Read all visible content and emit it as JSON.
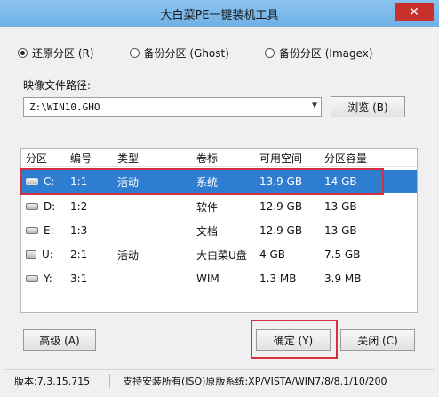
{
  "window": {
    "title": "大白菜PE一键装机工具",
    "close_glyph": "✕"
  },
  "modes": [
    {
      "label": "还原分区 (R)",
      "checked": true
    },
    {
      "label": "备份分区 (Ghost)",
      "checked": false
    },
    {
      "label": "备份分区 (Imagex)",
      "checked": false
    }
  ],
  "image_path": {
    "label": "映像文件路径:",
    "value": "Z:\\WIN10.GHO",
    "browse_label": "浏览 (B)"
  },
  "table": {
    "columns": [
      "分区",
      "编号",
      "类型",
      "卷标",
      "可用空间",
      "分区容量"
    ],
    "rows": [
      {
        "drive": "C:",
        "num": "1:1",
        "type": "活动",
        "label": "系统",
        "free": "13.9 GB",
        "size": "14 GB",
        "selected": true,
        "icon": "hdd-icon"
      },
      {
        "drive": "D:",
        "num": "1:2",
        "type": "",
        "label": "软件",
        "free": "12.9 GB",
        "size": "13 GB",
        "selected": false,
        "icon": "hdd-icon"
      },
      {
        "drive": "E:",
        "num": "1:3",
        "type": "",
        "label": "文档",
        "free": "12.9 GB",
        "size": "13 GB",
        "selected": false,
        "icon": "hdd-icon"
      },
      {
        "drive": "U:",
        "num": "2:1",
        "type": "活动",
        "label": "大白菜U盘",
        "free": "4 GB",
        "size": "7.5 GB",
        "selected": false,
        "icon": "usb-drive-icon"
      },
      {
        "drive": "Y:",
        "num": "3:1",
        "type": "",
        "label": "WIM",
        "free": "1.3 MB",
        "size": "3.9 MB",
        "selected": false,
        "icon": "hdd-icon"
      }
    ]
  },
  "buttons": {
    "advanced": "高级 (A)",
    "ok": "确定 (Y)",
    "close": "关闭 (C)"
  },
  "status": {
    "version": "版本:7.3.15.715",
    "support": "支持安装所有(ISO)原版系统:XP/VISTA/WIN7/8/8.1/10/200"
  },
  "colors": {
    "highlight": "#d2323f",
    "selection": "#2f7dd1"
  }
}
